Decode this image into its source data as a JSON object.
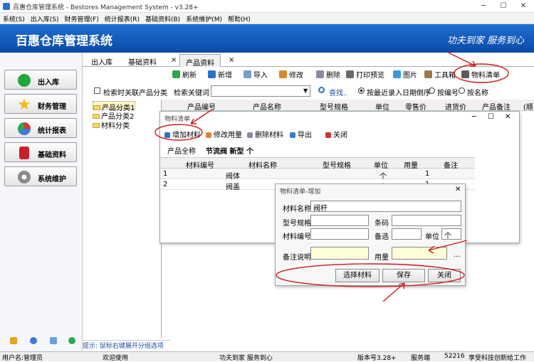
{
  "window": {
    "title": "百惠仓库管理系统 - Bestores Management System - v3.28+",
    "min": "─",
    "max": "☐",
    "close": "✕"
  },
  "menu": [
    "系统(S)",
    "出入库(S)",
    "财务管理(F)",
    "统计报表(R)",
    "基础资料(B)",
    "系统维护(M)",
    "帮助(H)"
  ],
  "banner": {
    "title": "百惠仓库管理系统",
    "slogan": "功夫到家 服务到心"
  },
  "nav": [
    {
      "label": "出入库",
      "icon": "checkmark-icon",
      "color": "#22a83a"
    },
    {
      "label": "财务管理",
      "icon": "star-icon",
      "color": "#f2b81e"
    },
    {
      "label": "统计报表",
      "icon": "pie-chart-icon",
      "color": "#3a7bd5"
    },
    {
      "label": "基础资料",
      "icon": "book-icon",
      "color": "#c8202a"
    },
    {
      "label": "系统维护",
      "icon": "gear-icon",
      "color": "#8a8a8a"
    }
  ],
  "tabs": [
    "出入库",
    "基础资料",
    "产品资料"
  ],
  "tab_close": "×",
  "toolbar": [
    "刷新",
    "新增",
    "导入",
    "修改",
    "删除",
    "打印预览",
    "图片",
    "工具箱",
    "物料清单"
  ],
  "search": {
    "checkbox": "检索时关联产品分类",
    "label": "检索关键词",
    "button": "查找..",
    "sort_options": [
      "按最近录入日期倒序",
      "按编号",
      "按名称"
    ]
  },
  "tree": [
    "产品分类1",
    "产品分类2",
    "材料分类"
  ],
  "grid_headers": [
    "产品编号",
    "产品名称",
    "型号规格",
    "单位",
    "零售价",
    "进货价",
    "产品备注",
    "(顺"
  ],
  "hint": "提示: 鼠标右键展开分组选项",
  "status": {
    "user": "用户名:管理员",
    "welcome": "欢迎使用",
    "slogan": "功夫到家 服务到心",
    "version": "版本号3.28+",
    "service": "服务端",
    "port": "52216",
    "vendor": "享受科技创新给工作"
  },
  "bom": {
    "title": "物料清单",
    "btn_add": "增加材料",
    "btn_edit": "修改用量",
    "btn_del": "删除材料",
    "btn_export": "导出",
    "btn_close": "关闭",
    "prod_label": "产品全称",
    "prod_value": "节流阀 新型 个",
    "headers": [
      "材料编号",
      "材料名称",
      "型号规格",
      "单位",
      "用量",
      "备注"
    ],
    "rows": [
      {
        "n": "1",
        "code": "",
        "name": "阀体",
        "spec": "",
        "unit": "个",
        "qty": "1",
        "note": ""
      },
      {
        "n": "2",
        "code": "",
        "name": "阀盖",
        "spec": "",
        "unit": "个",
        "qty": "1",
        "note": ""
      }
    ]
  },
  "add": {
    "title": "物料清单-增加",
    "name_label": "材料名称",
    "name_value": "阀杆",
    "spec_label": "型号规格",
    "barcode_label": "条码",
    "code_label": "材料编号",
    "alt_label": "备选",
    "unit_label": "单位",
    "unit_value": "个",
    "note_label": "备注说明",
    "qty_label": "用量",
    "ellipsis": "...",
    "btn_select": "选择材料",
    "btn_save": "保存",
    "btn_close": "关闭"
  }
}
